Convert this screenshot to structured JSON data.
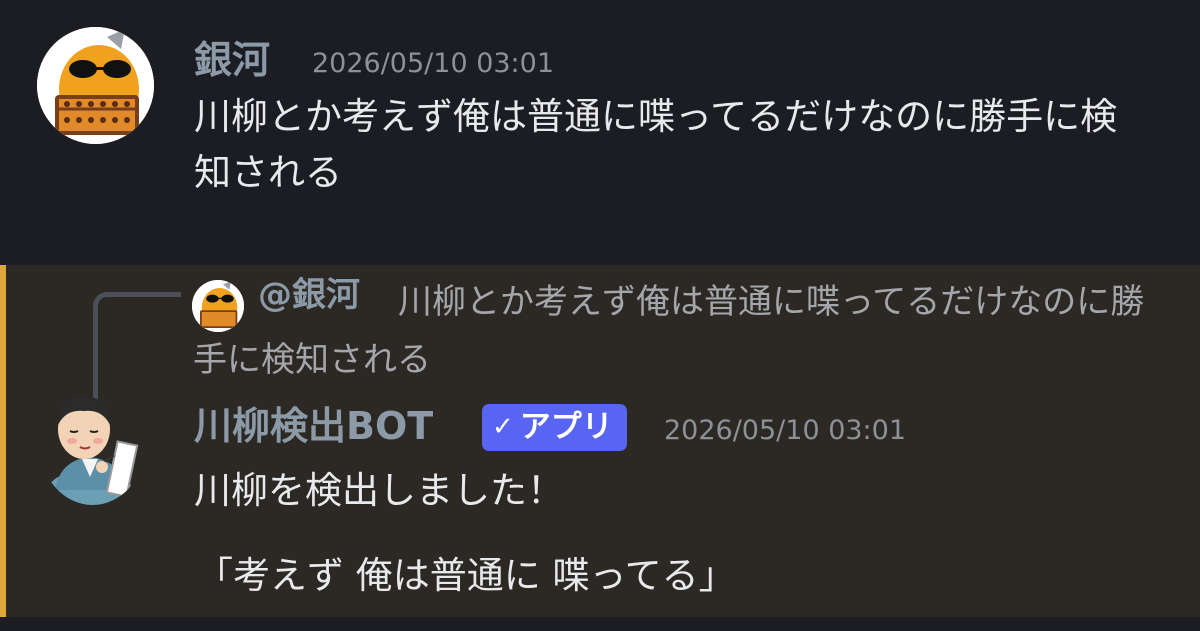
{
  "message1": {
    "author": "銀河",
    "timestamp": "2026/05/10 03:01",
    "text": "川柳とか考えず俺は普通に喋ってるだけなのに勝手に検知される"
  },
  "message2": {
    "reply": {
      "mention": "@銀河",
      "text": "川柳とか考えず俺は普通に喋ってるだけなのに勝手に検知される"
    },
    "author": "川柳検出BOT",
    "badge": "アプリ",
    "badge_icon": "✓",
    "timestamp": "2026/05/10 03:01",
    "line1": "川柳を検出しました！",
    "line2": "「考えず 俺は普通に 喋ってる」"
  },
  "colors": {
    "background": "#1c1d22",
    "highlight_background": "#2c2924",
    "highlight_bar": "#e0a73a",
    "badge": "#5865f2",
    "username": "#8c9aa8"
  }
}
